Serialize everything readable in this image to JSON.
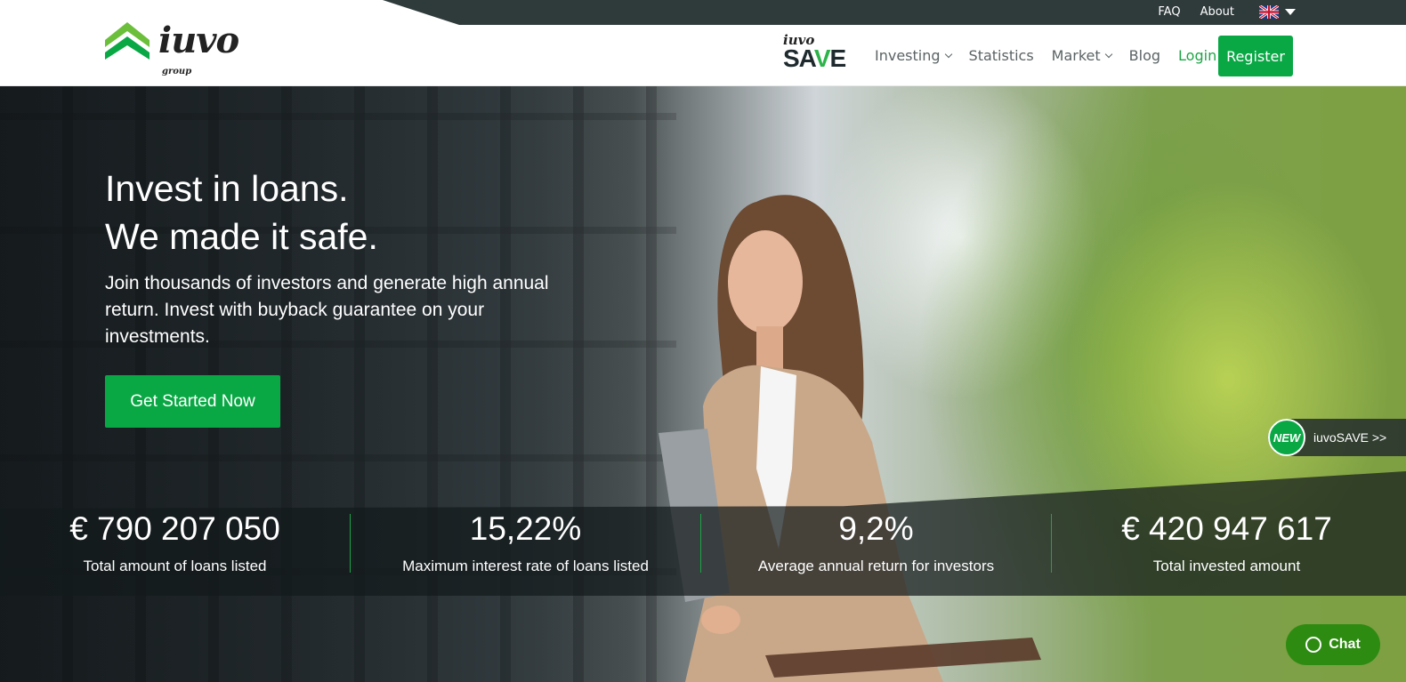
{
  "topbar": {
    "faq": "FAQ",
    "about": "About",
    "language_icon": "uk-flag-icon"
  },
  "header": {
    "logo_text": "iuvo",
    "logo_sub": "group",
    "save_logo_small": "iuvo",
    "save_logo_big_1": "SA",
    "save_logo_big_v": "V",
    "save_logo_big_2": "E",
    "nav": {
      "investing": "Investing",
      "statistics": "Statistics",
      "market": "Market",
      "blog": "Blog",
      "login": "Login",
      "register": "Register"
    }
  },
  "hero": {
    "headline_1": "Invest in loans.",
    "headline_2": "We made it safe.",
    "subline": "Join thousands of investors and generate high annual return. Invest with buyback guarantee on your investments.",
    "cta": "Get Started Now",
    "new_badge": "NEW",
    "new_label": "iuvoSAVE >>"
  },
  "stats": [
    {
      "value": "€ 790 207 050",
      "label": "Total amount of loans listed"
    },
    {
      "value": "15,22%",
      "label": "Maximum interest rate of loans listed"
    },
    {
      "value": "9,2%",
      "label": "Average annual return for investors"
    },
    {
      "value": "€ 420 947 617",
      "label": "Total invested amount"
    }
  ],
  "chat": {
    "label": "Chat"
  },
  "colors": {
    "brand_green": "#0aa845",
    "dark": "#2f3a3b"
  }
}
